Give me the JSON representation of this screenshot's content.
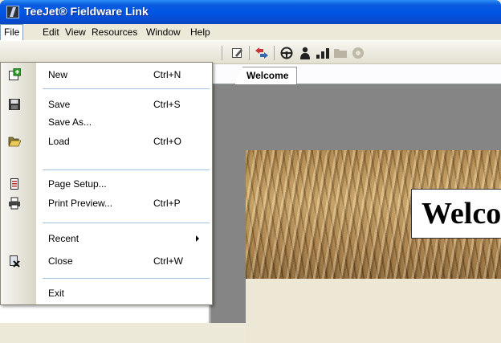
{
  "window": {
    "title": "TeeJet® Fieldware Link"
  },
  "menubar": {
    "items": [
      "File",
      "Edit",
      "View",
      "Resources",
      "Window",
      "Help"
    ],
    "active": "File"
  },
  "toolbar": {
    "icons": [
      "edit-icon",
      "swap-arrows-icon",
      "steering-wheel-icon",
      "person-icon",
      "chart-icon",
      "folder-icon",
      "disc-icon"
    ]
  },
  "tabs": [
    {
      "label": "Welcome",
      "active": true
    }
  ],
  "welcome_banner": {
    "heading": "Welco"
  },
  "file_menu": {
    "items": [
      {
        "label": "New",
        "shortcut": "Ctrl+N",
        "icon": "new-icon"
      },
      {
        "label": "Save",
        "shortcut": "Ctrl+S",
        "icon": "save-icon"
      },
      {
        "label": "Save As...",
        "shortcut": "",
        "icon": ""
      },
      {
        "label": "Load",
        "shortcut": "Ctrl+O",
        "icon": "open-folder-icon"
      },
      {
        "label": "Page Setup...",
        "shortcut": "",
        "icon": "page-setup-icon"
      },
      {
        "label": "Print Preview...",
        "shortcut": "Ctrl+P",
        "icon": "printer-icon"
      },
      {
        "label": "Recent",
        "shortcut": "",
        "icon": "",
        "submenu": true
      },
      {
        "label": "Close",
        "shortcut": "Ctrl+W",
        "icon": "close-document-icon"
      },
      {
        "label": "Exit",
        "shortcut": "",
        "icon": ""
      }
    ]
  },
  "colors": {
    "title_bar": "#0054e3",
    "menu_separator": "#a7c1e0",
    "workspace_frame": "#858585"
  }
}
